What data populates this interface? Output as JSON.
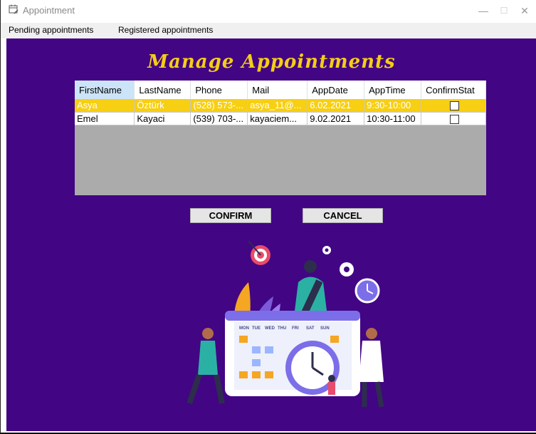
{
  "window": {
    "title": "Appointment",
    "minimize_label": "—",
    "maximize_label": "☐",
    "close_label": "✕"
  },
  "menu": {
    "items": [
      "Pending appointments",
      "Registered appointments"
    ]
  },
  "main": {
    "heading": "Manage Appointments"
  },
  "grid": {
    "columns": [
      "FirstName",
      "LastName",
      "Phone",
      "Mail",
      "AppDate",
      "AppTime",
      "ConfirmStat"
    ],
    "selected_column": 0,
    "rows": [
      {
        "first_name": "Asya",
        "last_name": "Öztürk",
        "phone": "(528) 573-...",
        "mail": "asya_11@...",
        "app_date": "6.02.2021",
        "app_time": "9:30-10:00",
        "confirmed": false,
        "selected": true
      },
      {
        "first_name": "Emel",
        "last_name": "Kayaci",
        "phone": "(539) 703-...",
        "mail": "kayaciem...",
        "app_date": "9.02.2021",
        "app_time": "10:30-11:00",
        "confirmed": false,
        "selected": false
      }
    ]
  },
  "actions": {
    "confirm_label": "CONFIRM",
    "cancel_label": "CANCEL"
  },
  "illustration": {
    "calendar_days": [
      "MON",
      "TUE",
      "WED",
      "THU",
      "FRI",
      "SAT",
      "SUN"
    ]
  },
  "colors": {
    "background": "#420584",
    "heading": "#f4cd17",
    "selected_row": "#f7cf13",
    "grid_empty": "#ababab",
    "header_selected": "#cce4f7"
  },
  "icons": {
    "title": "calendar-edit-icon"
  }
}
